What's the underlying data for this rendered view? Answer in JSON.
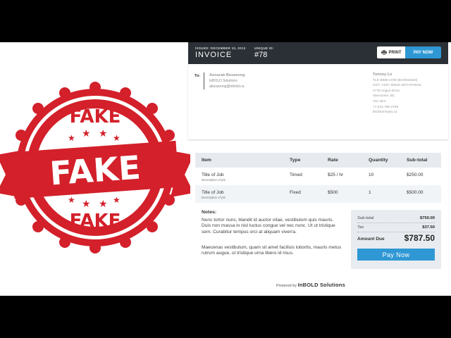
{
  "stamp": {
    "top_word": "FAKE",
    "banner_word": "FAKE",
    "bottom_word": "FAKE",
    "color": "#d3202a"
  },
  "header": {
    "issued_label": "ISSUED: DECEMBER 10, 2013",
    "title": "INVOICE",
    "uid_label": "UNIQUE ID:",
    "uid_value": "#78",
    "print_label": "PRINT",
    "print_icon": "printer-icon",
    "pay_now_label": "PAY NOW",
    "bg_color": "#2b3036",
    "accent": "#2f98d4"
  },
  "to": {
    "label": "To:",
    "name": "Anourak Bosavong",
    "company": "InBOLD Solutions",
    "email": "abosavong@inbold.ca"
  },
  "from": {
    "name": "Tommy Lo",
    "lines": [
      "TLE WEB COM (BC0944320)",
      "GST / HST: 80540 4573 RT0011",
      "4778 Angus Drive,",
      "Vancouver, BC",
      "V6J 4E4",
      "+1 514 795 2785",
      "tle@tommylo.ca"
    ]
  },
  "table": {
    "headers": [
      "Item",
      "Type",
      "Rate",
      "Quantity",
      "Sub-total"
    ],
    "rows": [
      {
        "item": "Title of Job",
        "desc": "Description of job",
        "type": "Timed",
        "rate": "$25 / hr",
        "qty": "10",
        "subtotal": "$250.00"
      },
      {
        "item": "Title of Job",
        "desc": "Description of job",
        "type": "Fixed",
        "rate": "$500",
        "qty": "1",
        "subtotal": "$500.00"
      }
    ]
  },
  "notes": {
    "title": "Notes:",
    "p1": "Nunc tortor nunc, blandit id auctor vitae, vestibulum quis mauris. Duis non massa in nisl luctus congue vel nec nunc. Ut ut tristique sem. Curabitur tempus orci at aliquam viverra.",
    "p2": "Maecenas vestibulum, quam sit amet facilisis lobortis, mauris metus rutrum augue, ut tristique urna libero id risus."
  },
  "totals": {
    "subtotal_label": "Sub-total",
    "subtotal": "$750.00",
    "tax_label": "Tax",
    "tax": "$37.50",
    "due_label": "Amount Due",
    "due": "$787.50",
    "pay_label": "Pay Now"
  },
  "footer": {
    "powered_by": "Powered by",
    "brand": "InBOLD Solutions"
  }
}
